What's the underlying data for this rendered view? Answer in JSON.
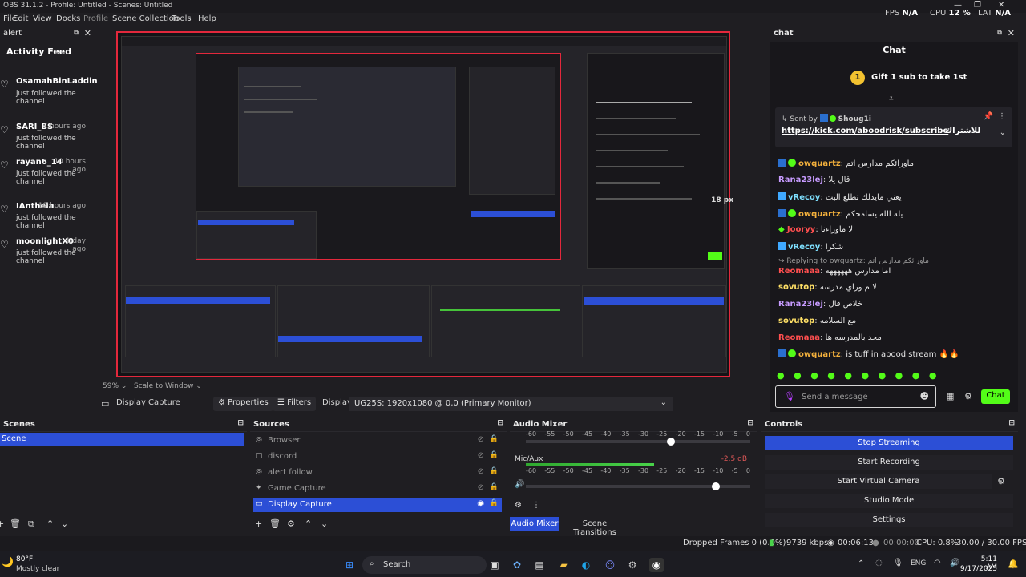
{
  "window": {
    "title": "OBS 31.1.2 - Profile: Untitled - Scenes: Untitled",
    "fps_label": "FPS",
    "fps_value": "N/A",
    "cpu_label": "CPU",
    "cpu_value": "12 %",
    "lat_label": "LAT",
    "lat_value": "N/A"
  },
  "menu": [
    "Edit",
    "View",
    "Docks",
    "Profile",
    "Scene Collection",
    "Tools",
    "Help"
  ],
  "alert_dock": {
    "title": "alert",
    "heading": "Activity Feed",
    "items": [
      {
        "name": "OsamahBinLaddin",
        "time": "",
        "action": "just followed the channel"
      },
      {
        "name": "SARI_BS",
        "time": "7 hours ago",
        "action": "just followed the channel"
      },
      {
        "name": "rayan6_14",
        "time": "10 hours ago",
        "action": "just followed the channel"
      },
      {
        "name": "IAntheia",
        "time": "19 hours ago",
        "action": "just followed the channel"
      },
      {
        "name": "moonlightX0",
        "time": "1 day ago",
        "action": "just followed the channel"
      }
    ]
  },
  "preview": {
    "label_18px": "18 px"
  },
  "preview_toolbar": {
    "zoom": "59%",
    "scale": "Scale to Window",
    "source_name": "Display Capture",
    "properties": "Properties",
    "filters": "Filters",
    "display_label": "Display",
    "display_value": "UG25S: 1920x1080 @ 0,0 (Primary Monitor)"
  },
  "chat": {
    "dock_title": "chat",
    "heading": "Chat",
    "gift_text": "Gift 1 sub to take 1st",
    "pinned_sent_by": "Sent by",
    "pinned_user": "Shoug1i",
    "pinned_link": "https://kick.com/aboodrisk/subscribe",
    "pinned_suffix": "للاشتراك",
    "messages": [
      {
        "user": "owquartz",
        "color": "#f4b13c",
        "text": "ماورائكم مدارس اتم"
      },
      {
        "user": "Rana23lej",
        "color": "#c79bff",
        "text": "قال يلا"
      },
      {
        "user": "vRecoy",
        "color": "#7ee0ff",
        "text": "يعني مايدلك تطلع البث"
      },
      {
        "user": "owquartz",
        "color": "#f4b13c",
        "text": "يله الله يسامحكم"
      },
      {
        "user": "Jooryy",
        "color": "#ff4f4f",
        "text": "لا ماوراءنا"
      },
      {
        "user": "vRecoy",
        "color": "#7ee0ff",
        "text": "شكرا"
      },
      {
        "user": "Reomaaa",
        "color": "#ff4f4f",
        "text": "اما مدارس ههههههه"
      },
      {
        "user": "sovutop",
        "color": "#ffe066",
        "text": "لا م وراي مدرسه"
      },
      {
        "user": "Rana23lej",
        "color": "#c79bff",
        "text": "خلاص قال"
      },
      {
        "user": "sovutop",
        "color": "#ffe066",
        "text": "مع السلامه"
      },
      {
        "user": "Reomaaa",
        "color": "#ff4f4f",
        "text": "محد بالمدرسه ها"
      },
      {
        "user": "owquartz",
        "color": "#f4b13c",
        "text": "is tuff in abood stream"
      }
    ],
    "reply_label": "Replying to owquartz:",
    "reply_text": "ماورائكم مدارس اتم",
    "input_placeholder": "Send a message",
    "send_label": "Chat"
  },
  "scenes": {
    "title": "Scenes",
    "items": [
      "Scene"
    ]
  },
  "sources": {
    "title": "Sources",
    "items": [
      "Browser",
      "discord",
      "alert follow",
      "Game Capture",
      "Display Capture"
    ]
  },
  "audio": {
    "title": "Audio Mixer",
    "channel2": "Mic/Aux",
    "channel2_db": "-2.5 dB",
    "tick_labels": [
      "-60",
      "-55",
      "-50",
      "-45",
      "-40",
      "-35",
      "-30",
      "-25",
      "-20",
      "-15",
      "-10",
      "-5",
      "0"
    ],
    "tab_mixer": "Audio Mixer",
    "tab_transitions": "Scene Transitions"
  },
  "controls": {
    "title": "Controls",
    "stop_streaming": "Stop Streaming",
    "start_recording": "Start Recording",
    "start_virtual_camera": "Start Virtual Camera",
    "studio_mode": "Studio Mode",
    "settings": "Settings"
  },
  "status": {
    "dropped": "Dropped Frames 0 (0.0%)",
    "bitrate": "9739 kbps",
    "stream_time": "00:06:13",
    "rec_time": "00:00:00",
    "cpu": "CPU: 0.8%",
    "fps": "30.00 / 30.00 FPS"
  },
  "taskbar": {
    "weather_temp": "80°F",
    "weather_desc": "Mostly clear",
    "search": "Search",
    "lang": "ENG",
    "time": "5:11 AM",
    "date": "9/17/2025"
  }
}
